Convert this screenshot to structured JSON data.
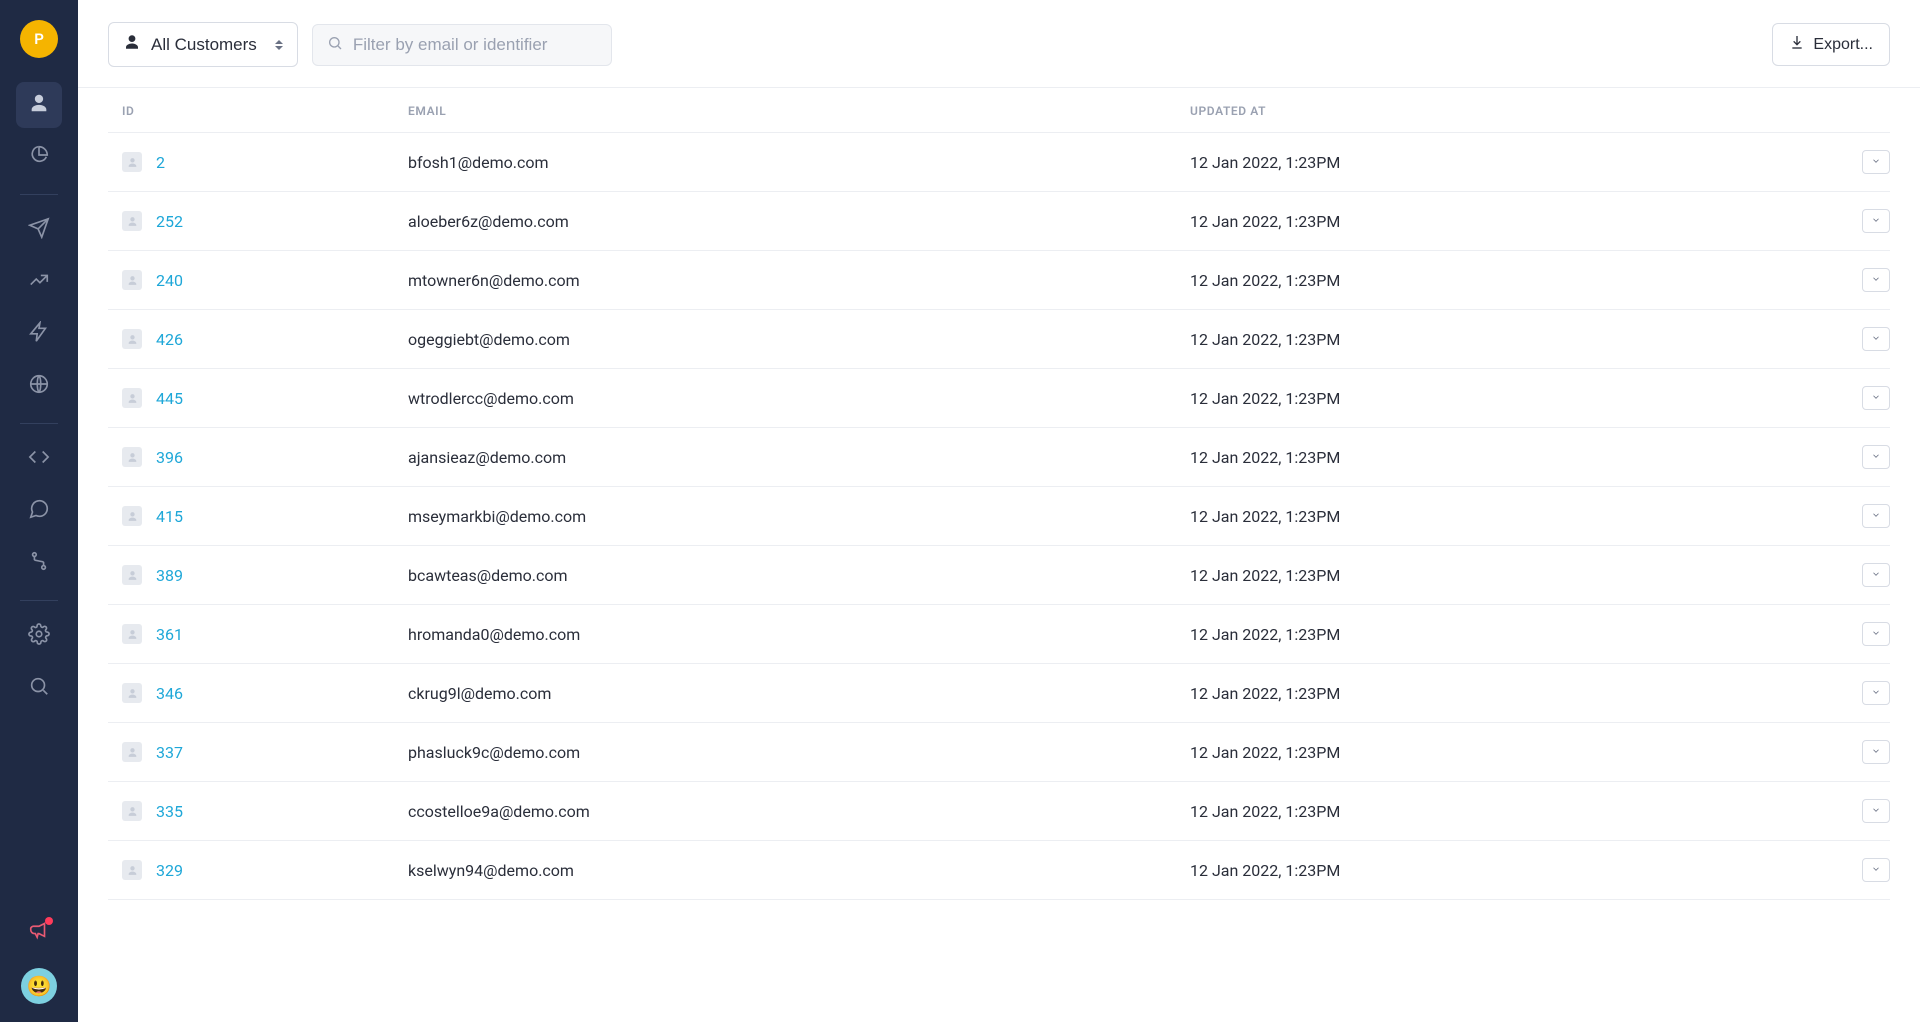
{
  "sidebar": {
    "avatar_letter": "P"
  },
  "topbar": {
    "filter_label": "All Customers",
    "search_placeholder": "Filter by email or identifier",
    "export_label": "Export..."
  },
  "table": {
    "headers": {
      "id": "ID",
      "email": "EMAIL",
      "updated_at": "UPDATED AT"
    },
    "rows": [
      {
        "id": "2",
        "email": "bfosh1@demo.com",
        "updated_at": "12 Jan 2022, 1:23PM"
      },
      {
        "id": "252",
        "email": "aloeber6z@demo.com",
        "updated_at": "12 Jan 2022, 1:23PM"
      },
      {
        "id": "240",
        "email": "mtowner6n@demo.com",
        "updated_at": "12 Jan 2022, 1:23PM"
      },
      {
        "id": "426",
        "email": "ogeggiebt@demo.com",
        "updated_at": "12 Jan 2022, 1:23PM"
      },
      {
        "id": "445",
        "email": "wtrodlercc@demo.com",
        "updated_at": "12 Jan 2022, 1:23PM"
      },
      {
        "id": "396",
        "email": "ajansieaz@demo.com",
        "updated_at": "12 Jan 2022, 1:23PM"
      },
      {
        "id": "415",
        "email": "mseymarkbi@demo.com",
        "updated_at": "12 Jan 2022, 1:23PM"
      },
      {
        "id": "389",
        "email": "bcawteas@demo.com",
        "updated_at": "12 Jan 2022, 1:23PM"
      },
      {
        "id": "361",
        "email": "hromanda0@demo.com",
        "updated_at": "12 Jan 2022, 1:23PM"
      },
      {
        "id": "346",
        "email": "ckrug9l@demo.com",
        "updated_at": "12 Jan 2022, 1:23PM"
      },
      {
        "id": "337",
        "email": "phasluck9c@demo.com",
        "updated_at": "12 Jan 2022, 1:23PM"
      },
      {
        "id": "335",
        "email": "ccostelloe9a@demo.com",
        "updated_at": "12 Jan 2022, 1:23PM"
      },
      {
        "id": "329",
        "email": "kselwyn94@demo.com",
        "updated_at": "12 Jan 2022, 1:23PM"
      }
    ]
  }
}
